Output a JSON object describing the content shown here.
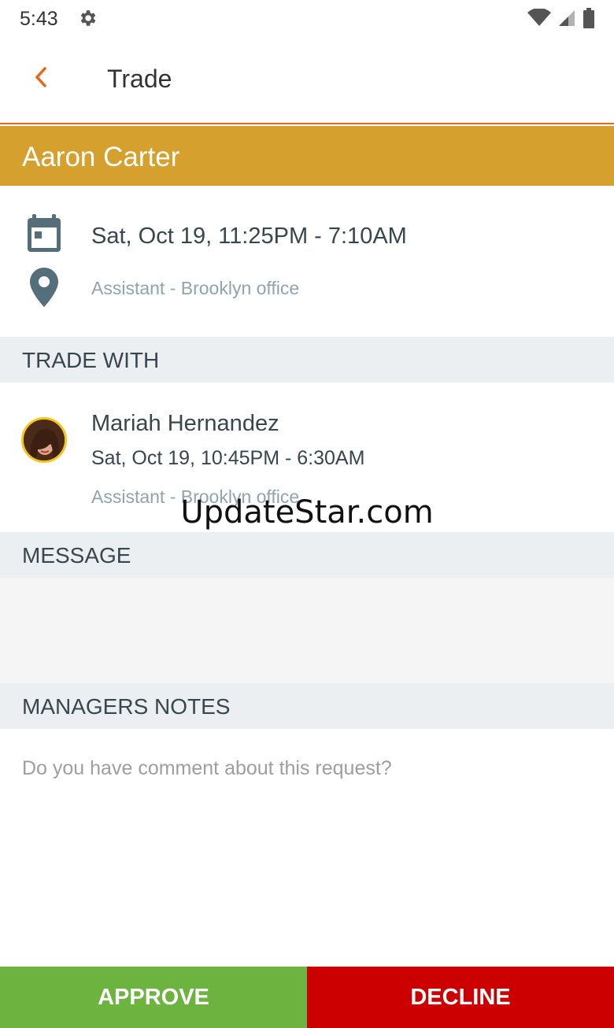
{
  "status_bar": {
    "time": "5:43"
  },
  "app_bar": {
    "title": "Trade"
  },
  "requester": {
    "name": "Aaron Carter",
    "shift_time": "Sat, Oct 19, 11:25PM - 7:10AM",
    "location": "Assistant - Brooklyn office"
  },
  "sections": {
    "trade_with": "TRADE WITH",
    "message": "MESSAGE",
    "managers_notes": "MANAGERS NOTES"
  },
  "trade_with": {
    "name": "Mariah Hernandez",
    "shift_time": "Sat, Oct 19, 10:45PM - 6:30AM",
    "location": "Assistant - Brooklyn office"
  },
  "notes": {
    "placeholder": "Do you have comment about this request?"
  },
  "watermark": "UpdateStar.com",
  "actions": {
    "approve": "APPROVE",
    "decline": "DECLINE"
  },
  "colors": {
    "banner": "#d5a02e",
    "accent": "#e8651a",
    "approve": "#6db33f",
    "decline": "#cc0000"
  }
}
